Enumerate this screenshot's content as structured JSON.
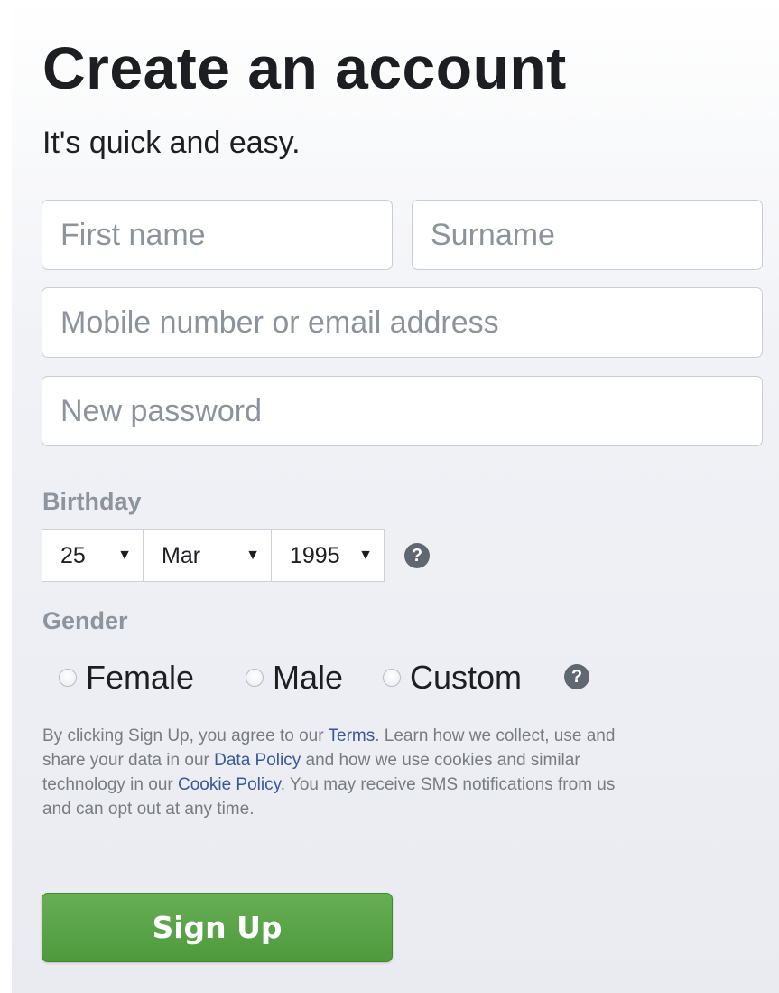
{
  "header": {
    "title": "Create an account",
    "subtitle": "It's quick and easy."
  },
  "form": {
    "first_name_placeholder": "First name",
    "surname_placeholder": "Surname",
    "contact_placeholder": "Mobile number or email address",
    "password_placeholder": "New password"
  },
  "birthday": {
    "label": "Birthday",
    "day": "25",
    "month": "Mar",
    "year": "1995",
    "help_icon": "question-circle-icon",
    "help_glyph": "?"
  },
  "gender": {
    "label": "Gender",
    "options": [
      "Female",
      "Male",
      "Custom"
    ],
    "help_icon": "question-circle-icon",
    "help_glyph": "?"
  },
  "terms": {
    "text_1": "By clicking Sign Up, you agree to our ",
    "link_terms": "Terms",
    "text_2": ". Learn how we collect, use and share your data in our ",
    "link_data_policy": "Data Policy",
    "text_3": " and how we use cookies and similar technology in our ",
    "link_cookie_policy": "Cookie Policy",
    "text_4": ". You may receive SMS notifications from us and can opt out at any time."
  },
  "actions": {
    "signup_label": "Sign Up"
  },
  "colors": {
    "signup_green": "#5aa548",
    "link_blue": "#385898",
    "label_gray": "#8d949e"
  }
}
